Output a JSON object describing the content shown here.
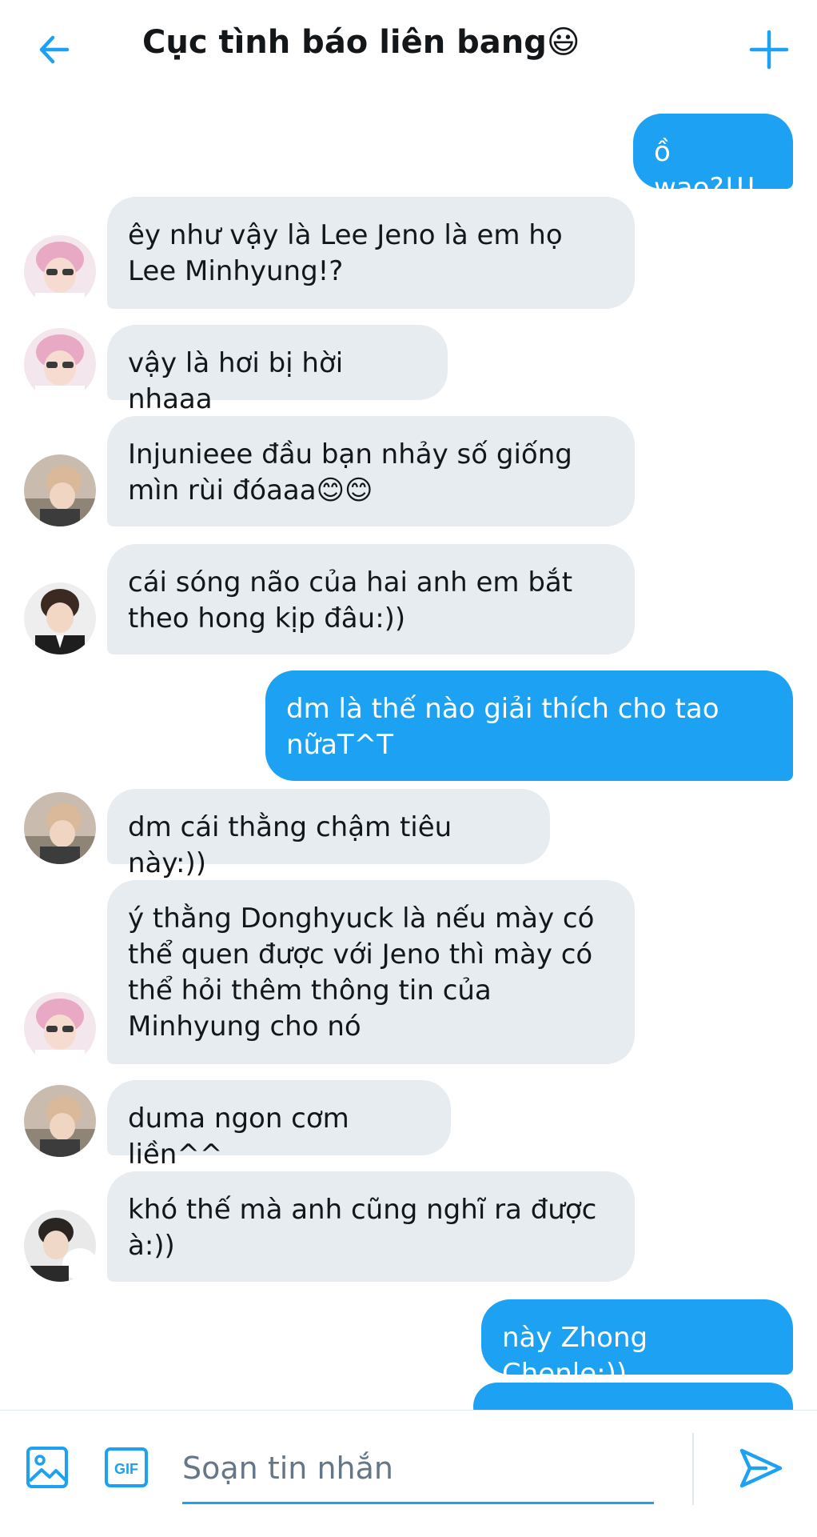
{
  "header": {
    "back_icon": "arrow-left-icon",
    "title": "Cục tình báo liên bang😃",
    "add_icon": "plus-icon",
    "accent": "#1da1f2"
  },
  "messages": [
    {
      "dir": "out",
      "text": "ồ wao?!!!"
    },
    {
      "dir": "in",
      "text": "êy như vậy là Lee Jeno là em họ Lee Minhyung!?"
    },
    {
      "dir": "in",
      "text": "vậy là hơi bị hời nhaaa"
    },
    {
      "dir": "in",
      "text": "Injunieee đầu bạn nhảy số giống mìn rùi đóaaa😊😊"
    },
    {
      "dir": "in",
      "text": "cái sóng não của hai anh em bắt theo hong kịp đâu:))"
    },
    {
      "dir": "out",
      "text": "dm là thế nào giải thích cho tao nữaT^T"
    },
    {
      "dir": "in",
      "text": "dm cái thằng chậm tiêu này:))"
    },
    {
      "dir": "in",
      "text": "ý thằng Donghyuck là nếu mày có thể quen được với Jeno thì mày có thể hỏi thêm thông tin của Minhyung cho nó"
    },
    {
      "dir": "in",
      "text": "duma ngon cơm liền^^"
    },
    {
      "dir": "in",
      "text": "khó thế mà anh cũng nghĩ ra được à:))"
    },
    {
      "dir": "out",
      "text": "này Zhong Chenle:))"
    }
  ],
  "composer": {
    "image_icon": "image-icon",
    "gif_label": "GIF",
    "placeholder": "Soạn tin nhắn",
    "send_icon": "send-icon"
  },
  "colors": {
    "incoming_bubble": "#e6ecf0",
    "outgoing_bubble": "#1da1f2"
  }
}
